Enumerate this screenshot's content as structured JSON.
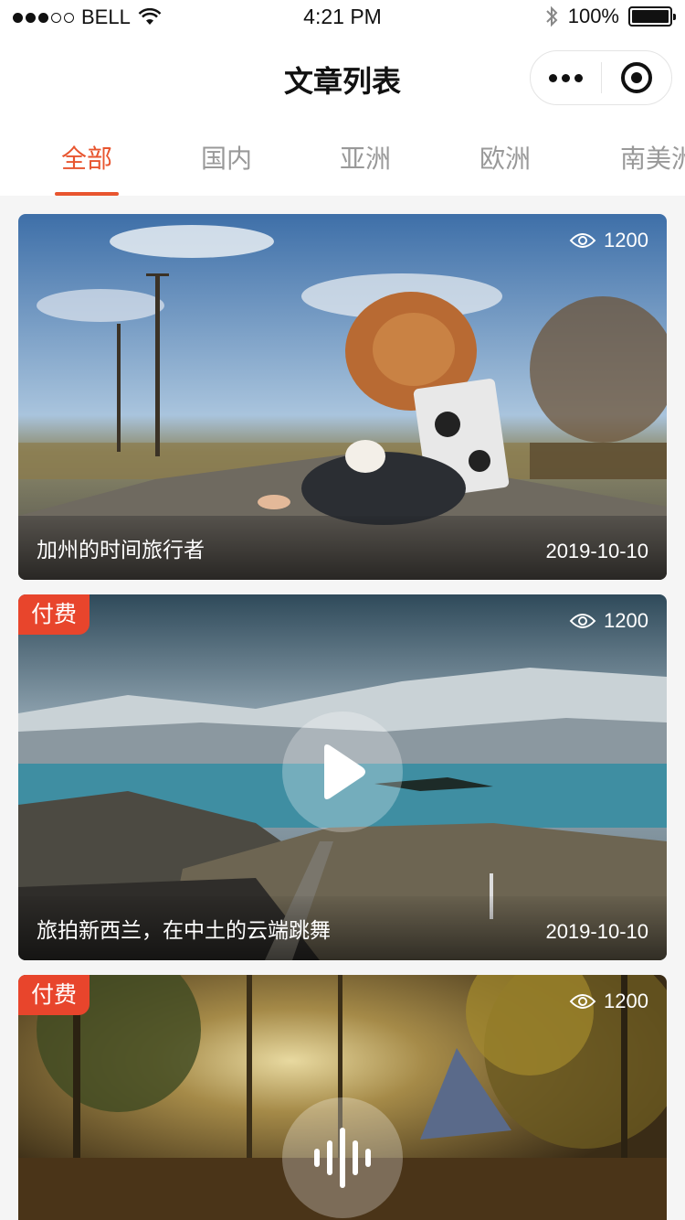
{
  "status_bar": {
    "carrier": "BELL",
    "time": "4:21 PM",
    "battery": "100%"
  },
  "nav": {
    "title": "文章列表"
  },
  "tabs": [
    {
      "label": "全部",
      "active": true
    },
    {
      "label": "国内",
      "active": false
    },
    {
      "label": "亚洲",
      "active": false
    },
    {
      "label": "欧洲",
      "active": false
    },
    {
      "label": "南美洲",
      "active": false
    }
  ],
  "colors": {
    "accent": "#e8552f",
    "badge": "#e8452c"
  },
  "articles": [
    {
      "title": "加州的时间旅行者",
      "date": "2019-10-10",
      "views": "1200",
      "paid_label": "",
      "media": "none"
    },
    {
      "title": "旅拍新西兰，在中土的云端跳舞",
      "date": "2019-10-10",
      "views": "1200",
      "paid_label": "付费",
      "media": "play-icon"
    },
    {
      "title": "",
      "date": "",
      "views": "1200",
      "paid_label": "付费",
      "media": "audio-icon"
    }
  ]
}
